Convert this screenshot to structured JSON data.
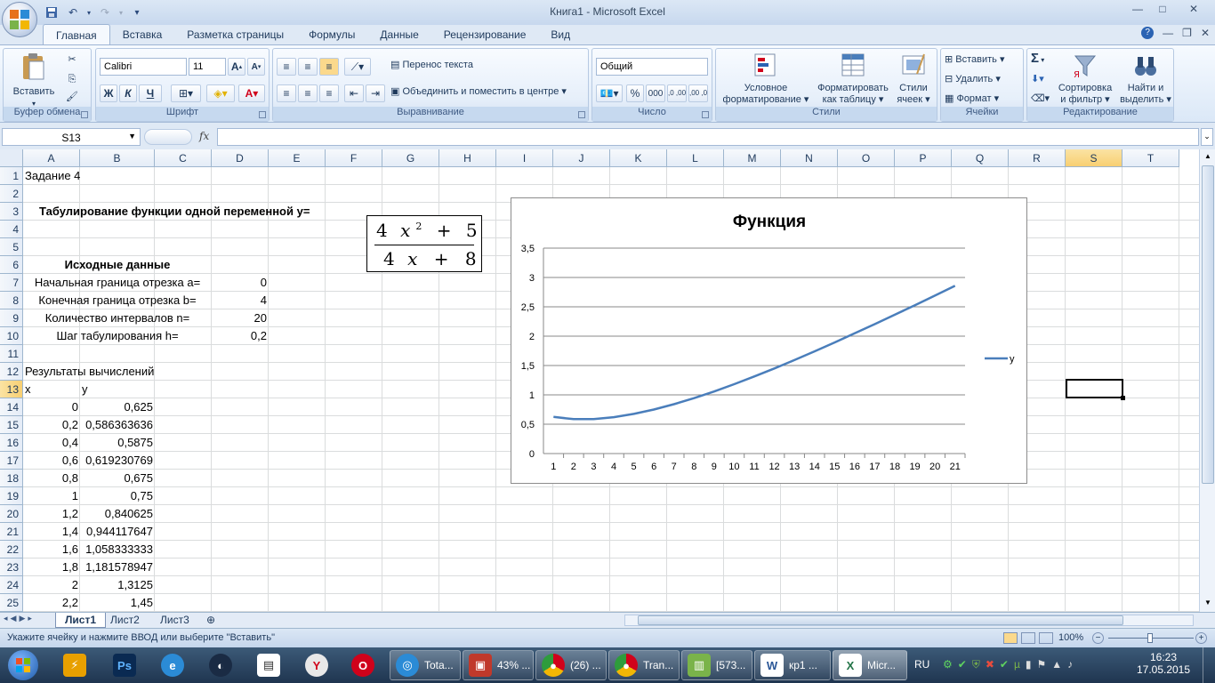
{
  "window": {
    "title": "Книга1  -  Microsoft Excel",
    "qat": [
      "save-icon",
      "undo-icon",
      "redo-icon",
      "customize-icon"
    ],
    "controls": [
      "—",
      "□",
      "✕"
    ]
  },
  "ribbon": {
    "tabs": [
      "Главная",
      "Вставка",
      "Разметка страницы",
      "Формулы",
      "Данные",
      "Рецензирование",
      "Вид"
    ],
    "active_tab": "Главная",
    "groups": {
      "clipboard": {
        "name": "Буфер обмена",
        "paste": "Вставить"
      },
      "font": {
        "name": "Шрифт",
        "family": "Calibri",
        "size": "11",
        "bold": "Ж",
        "italic": "К",
        "underline": "Ч"
      },
      "alignment": {
        "name": "Выравнивание",
        "wrap": "Перенос текста",
        "merge": "Объединить и поместить в центре"
      },
      "number": {
        "name": "Число",
        "format": "Общий",
        "percent": "%",
        "thousands": "000",
        "inc_decimal": ",0 ,00",
        "dec_decimal": ",00 ,0"
      },
      "styles": {
        "name": "Стили",
        "conditional": "Условное\nформатирование",
        "conditional_1": "Условное",
        "conditional_2": "форматирование",
        "table_1": "Форматировать",
        "table_2": "как таблицу",
        "cell_1": "Стили",
        "cell_2": "ячеек"
      },
      "cells": {
        "name": "Ячейки",
        "insert": "Вставить",
        "delete": "Удалить",
        "format": "Формат"
      },
      "editing": {
        "name": "Редактирование",
        "sort_1": "Сортировка",
        "sort_2": "и фильтр",
        "find_1": "Найти и",
        "find_2": "выделить",
        "sum": "Σ"
      }
    }
  },
  "formula_bar": {
    "name_box": "S13",
    "fx": "fx",
    "value": ""
  },
  "sheet": {
    "columns": [
      "A",
      "B",
      "C",
      "D",
      "E",
      "F",
      "G",
      "H",
      "I",
      "J",
      "K",
      "L",
      "M",
      "N",
      "O",
      "P",
      "Q",
      "R",
      "S",
      "T"
    ],
    "selected_column": "S",
    "rows": [
      "1",
      "2",
      "3",
      "4",
      "5",
      "6",
      "7",
      "8",
      "9",
      "10",
      "11",
      "12",
      "13",
      "14",
      "15",
      "16",
      "17",
      "18",
      "19",
      "20",
      "21",
      "22",
      "23",
      "24",
      "25"
    ],
    "selected_row": "13",
    "cells": {
      "a1": "Задание 4",
      "title3": "Табулирование функции одной переменной y=",
      "title6": "Исходные данные",
      "l7": "Начальная граница отрезка a=",
      "v7": "0",
      "l8": "Конечная граница отрезка b=",
      "v8": "4",
      "l9": "Количество интервалов n=",
      "v9": "20",
      "l10": "Шаг табулирования h=",
      "v10": "0,2",
      "a12": "Результаты вычислений",
      "a13": "x",
      "b13": "y"
    },
    "table": [
      {
        "x": "0",
        "y": "0,625"
      },
      {
        "x": "0,2",
        "y": "0,586363636"
      },
      {
        "x": "0,4",
        "y": "0,5875"
      },
      {
        "x": "0,6",
        "y": "0,619230769"
      },
      {
        "x": "0,8",
        "y": "0,675"
      },
      {
        "x": "1",
        "y": "0,75"
      },
      {
        "x": "1,2",
        "y": "0,840625"
      },
      {
        "x": "1,4",
        "y": "0,944117647"
      },
      {
        "x": "1,6",
        "y": "1,058333333"
      },
      {
        "x": "1,8",
        "y": "1,181578947"
      },
      {
        "x": "2",
        "y": "1,3125"
      },
      {
        "x": "2,2",
        "y": "1,45"
      }
    ],
    "formula_image": {
      "num": [
        "4",
        "x",
        "2",
        "+",
        "5"
      ],
      "den": [
        "4",
        "x",
        "+",
        "8"
      ]
    }
  },
  "chart_data": {
    "type": "line",
    "title": "Функция",
    "categories": [
      "1",
      "2",
      "3",
      "4",
      "5",
      "6",
      "7",
      "8",
      "9",
      "10",
      "11",
      "12",
      "13",
      "14",
      "15",
      "16",
      "17",
      "18",
      "19",
      "20",
      "21"
    ],
    "series": [
      {
        "name": "y",
        "color": "#4a7ebb",
        "values": [
          0.625,
          0.586,
          0.588,
          0.619,
          0.675,
          0.75,
          0.841,
          0.944,
          1.058,
          1.182,
          1.313,
          1.45,
          1.593,
          1.741,
          1.893,
          2.048,
          2.205,
          2.365,
          2.527,
          2.691,
          2.857
        ]
      }
    ],
    "y_ticks": [
      "0",
      "0,5",
      "1",
      "1,5",
      "2",
      "2,5",
      "3",
      "3,5"
    ],
    "ylim": [
      0,
      3.5
    ],
    "grid": true,
    "legend": "right"
  },
  "sheet_tabs": [
    "Лист1",
    "Лист2",
    "Лист3"
  ],
  "active_sheet": "Лист1",
  "status": {
    "message": "Укажите ячейку и нажмите ВВОД или выберите \"Вставить\"",
    "zoom": "100%"
  },
  "taskbar": {
    "items": [
      {
        "label": "Tota...",
        "color": "#2b8bd6"
      },
      {
        "label": "43% ...",
        "color": "#c0392b"
      },
      {
        "label": "(26) ...",
        "color": "#e8b100"
      },
      {
        "label": "Tran...",
        "color": "#e8b100"
      },
      {
        "label": "[573...",
        "color": "#7ab34a"
      },
      {
        "label": "кр1 ...",
        "color": "#2b5797"
      },
      {
        "label": "Micr...",
        "color": "#217346"
      }
    ],
    "lang": "RU",
    "time": "16:23",
    "date": "17.05.2015"
  }
}
